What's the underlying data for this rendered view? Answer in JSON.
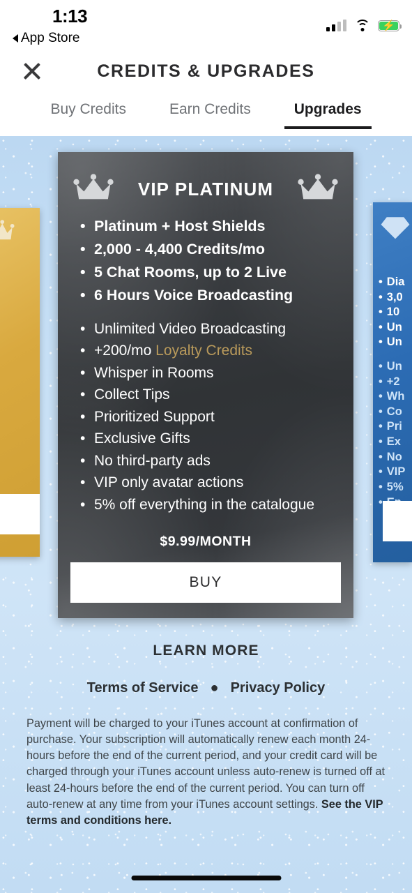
{
  "status_bar": {
    "time": "1:13",
    "back_label": "App Store",
    "back_icon": "triangle-left-icon",
    "signal_icon": "cellular-signal-icon",
    "wifi_icon": "wifi-icon",
    "battery_icon": "battery-charging-icon"
  },
  "nav": {
    "close_icon": "close-x-icon",
    "title": "CREDITS & UPGRADES"
  },
  "tabs": [
    {
      "label": "Buy Credits",
      "active": false
    },
    {
      "label": "Earn Credits",
      "active": false
    },
    {
      "label": "Upgrades",
      "active": true
    }
  ],
  "card": {
    "title": "VIP PLATINUM",
    "crown_icon": "crown-icon",
    "main_features": [
      "Platinum + Host Shields",
      "2,000 - 4,400 Credits/mo",
      "5 Chat Rooms, up to 2 Live",
      "6 Hours Voice Broadcasting"
    ],
    "sub_features": [
      {
        "text": "Unlimited Video Broadcasting"
      },
      {
        "text": "+200/mo ",
        "highlight": "Loyalty Credits"
      },
      {
        "text": "Whisper in Rooms"
      },
      {
        "text": "Collect Tips"
      },
      {
        "text": "Prioritized Support"
      },
      {
        "text": "Exclusive Gifts"
      },
      {
        "text": "No third-party ads"
      },
      {
        "text": "VIP only avatar actions"
      },
      {
        "text": "5% off everything in the catalogue"
      }
    ],
    "price": "$9.99/MONTH",
    "buy_label": "BUY",
    "colors": {
      "card_bg": "#34373b",
      "highlight_gold": "#b99a5b",
      "button_bg": "#ffffff"
    }
  },
  "side_card_left": {
    "crown_icon": "crown-icon",
    "color": "#d9a93f"
  },
  "side_card_right": {
    "diamond_icon": "diamond-icon",
    "color": "#2c6cb4",
    "main_features": [
      "Dia",
      "3,0",
      "10",
      "Un",
      "Un"
    ],
    "sub_features": [
      "Un",
      "+2",
      "Wh",
      "Co",
      "Pri",
      "Ex",
      "No",
      "VIP",
      "5%",
      "En"
    ]
  },
  "footer": {
    "learn_more": "LEARN MORE",
    "terms_label": "Terms of Service",
    "separator": "●",
    "privacy_label": "Privacy Policy",
    "legal_text": "Payment will be charged to your iTunes account at confirmation of purchase. Your subscription will automatically renew each month 24-hours before the end of the current period, and your credit card will be charged through your iTunes account unless auto-renew is turned off at least 24-hours before the end of the current period. You can turn off auto-renew at any time from your iTunes account settings. ",
    "legal_link": "See the VIP terms and conditions here."
  },
  "background_color": "#c7e0f6"
}
